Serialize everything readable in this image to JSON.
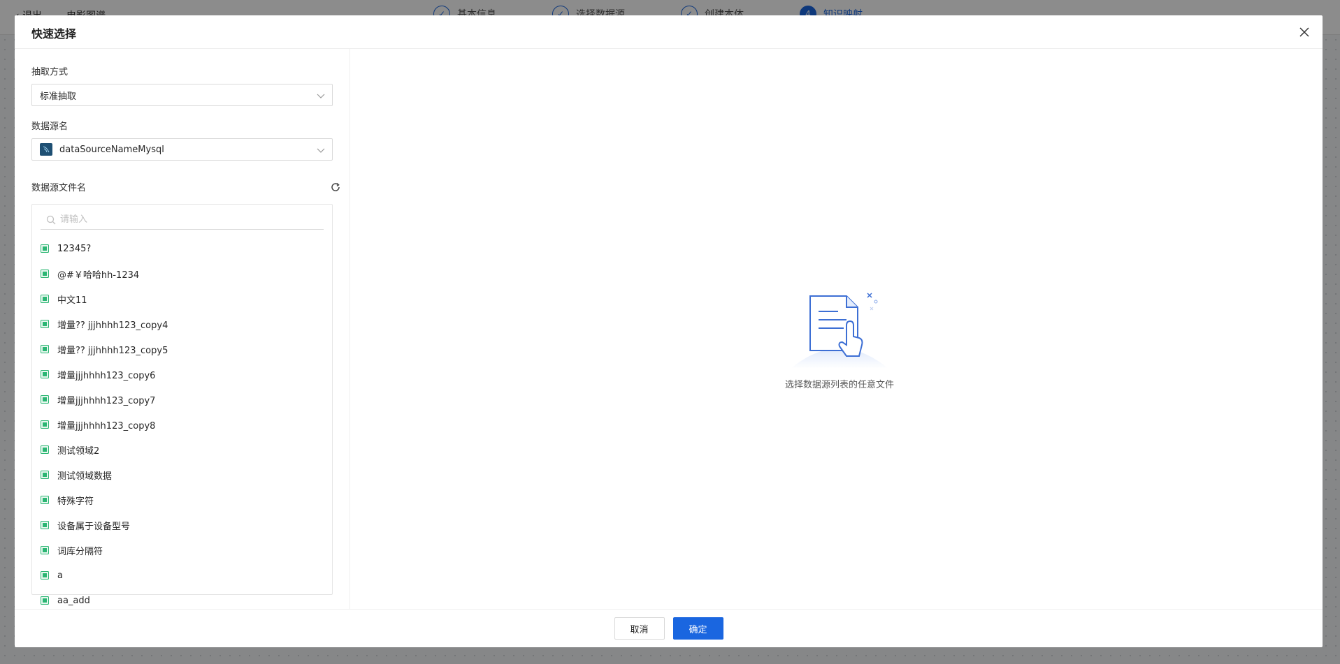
{
  "background": {
    "back_label": "退出",
    "page_title": "电影图谱",
    "steps": [
      {
        "label": "基本信息",
        "mark": "✓",
        "active": false
      },
      {
        "label": "选择数据源",
        "mark": "✓",
        "active": false
      },
      {
        "label": "创建本体",
        "mark": "✓",
        "active": false
      },
      {
        "label": "知识映射",
        "mark": "4",
        "active": true
      }
    ]
  },
  "modal": {
    "title": "快速选择",
    "extract_method": {
      "label": "抽取方式",
      "value": "标准抽取"
    },
    "datasource": {
      "label": "数据源名",
      "value": "dataSourceNameMysql",
      "icon": "mysql-icon"
    },
    "file_list": {
      "label": "数据源文件名",
      "search_placeholder": "请输入",
      "items": [
        "12345?",
        "@#￥哈哈hh-1234",
        "中文11",
        "增量?? jjjhhhh123_copy4",
        "增量?? jjjhhhh123_copy5",
        "增量jjjhhhh123_copy6",
        "增量jjjhhhh123_copy7",
        "增量jjjhhhh123_copy8",
        "测试领域2",
        "测试领域数据",
        "特殊字符",
        "设备属于设备型号",
        "词库分隔符",
        "a",
        "aa_add"
      ]
    },
    "empty_state": {
      "text": "选择数据源列表的任意文件"
    },
    "footer": {
      "cancel_label": "取消",
      "ok_label": "确定"
    }
  },
  "colors": {
    "primary": "#1a66e0",
    "file_icon": "#2bb673"
  }
}
